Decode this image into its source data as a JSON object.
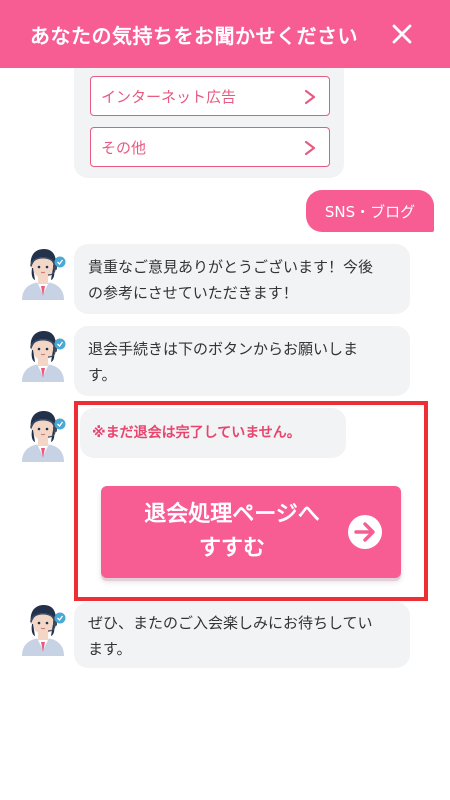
{
  "header": {
    "title": "あなたの気持ちをお聞かせください"
  },
  "options": [
    {
      "label": "インターネット広告"
    },
    {
      "label": "その他"
    }
  ],
  "user_reply": "SNS・ブログ",
  "messages": [
    {
      "text_line1": "貴重なご意見ありがとうございます！今後",
      "text_line2": "の参考にさせていただきます！"
    },
    {
      "text_line1": "退会手続きは下のボタンからお願いしま",
      "text_line2": "す。"
    },
    {
      "text": "※まだ退会は完了していません。"
    },
    {
      "text_line1": "ぜひ、またのご入会楽しみにお待ちしてい",
      "text_line2": "ます。"
    }
  ],
  "cta": {
    "line1": "退会処理ページへ",
    "line2": "すすむ"
  },
  "colors": {
    "brand": "#f75d92",
    "option_border": "#e75a81",
    "warning": "#e8456e",
    "highlight": "#ef2d34",
    "bubble_bg": "#f2f3f4"
  },
  "icons": {
    "close": "close-icon",
    "chevron": "chevron-right-icon",
    "arrow": "arrow-right-circle-icon",
    "avatar": "operator-avatar-icon"
  }
}
